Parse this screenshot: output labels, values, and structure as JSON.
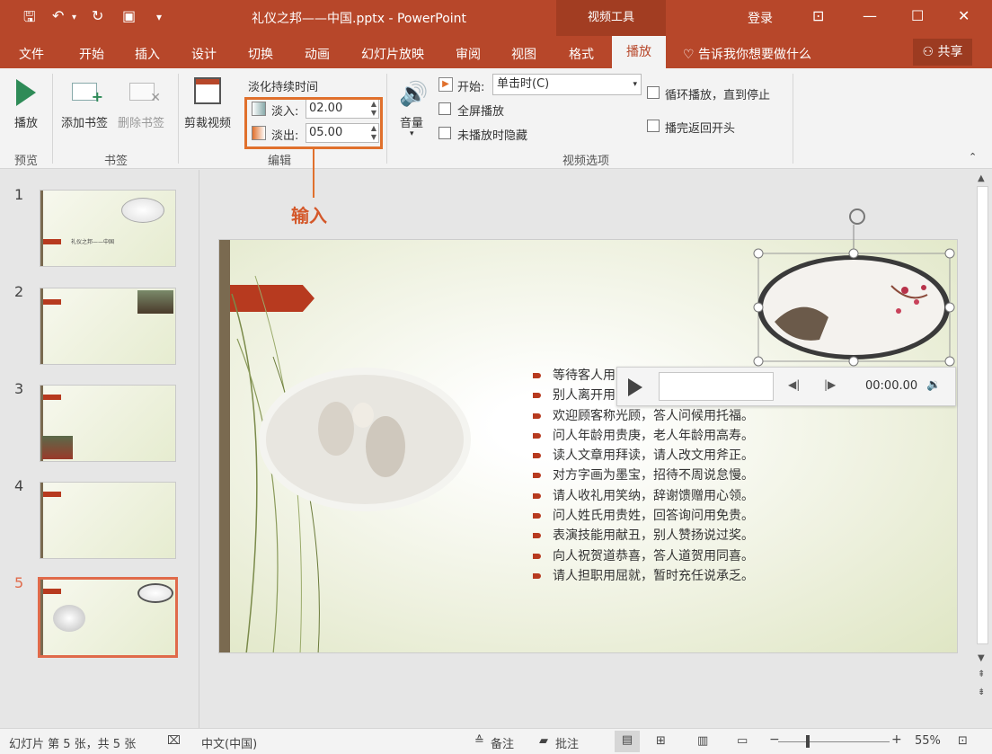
{
  "titlebar": {
    "title": "礼仪之邦——中国.pptx  -  PowerPoint",
    "context_tab": "视频工具",
    "login": "登录"
  },
  "tabs": {
    "file": "文件",
    "home": "开始",
    "insert": "插入",
    "design": "设计",
    "transitions": "切换",
    "animations": "动画",
    "slideshow": "幻灯片放映",
    "review": "审阅",
    "view": "视图",
    "format": "格式",
    "playback": "播放",
    "tellme": "告诉我你想要做什么",
    "share": "共享"
  },
  "ribbon": {
    "play": "播放",
    "add_bookmark": "添加书签",
    "remove_bookmark": "删除书签",
    "trim_video": "剪裁视频",
    "fade_duration": "淡化持续时间",
    "fade_in_label": "淡入:",
    "fade_in_value": "02.00",
    "fade_out_label": "淡出:",
    "fade_out_value": "05.00",
    "volume": "音量",
    "start_label": "开始:",
    "start_value": "单击时(C)",
    "fullscreen": "全屏播放",
    "hide_not_playing": "未播放时隐藏",
    "loop": "循环播放，直到停止",
    "rewind": "播完返回开头",
    "group_preview": "预览",
    "group_bookmarks": "书签",
    "group_editing": "编辑",
    "group_video_options": "视频选项"
  },
  "callout": "输入",
  "thumbnails": [
    {
      "num": "1",
      "caption": "礼仪之邦——中国"
    },
    {
      "num": "2"
    },
    {
      "num": "3"
    },
    {
      "num": "4"
    },
    {
      "num": "5"
    }
  ],
  "slide": {
    "lines": [
      "等待客人用",
      "别人离开用",
      "欢迎顾客称光顾，答人问候用托福。",
      "问人年龄用贵庚，老人年龄用高寿。",
      "读人文章用拜读，请人改文用斧正。",
      "对方字画为墨宝，招待不周说怠慢。",
      "请人收礼用笑纳，辞谢馈赠用心领。",
      "问人姓氏用贵姓，回答询问用免贵。",
      "表演技能用献丑，别人赞扬说过奖。",
      "向人祝贺道恭喜，答人道贺用同喜。",
      "请人担职用屈就，暂时充任说承乏。"
    ],
    "video_time": "00:00.00"
  },
  "statusbar": {
    "slide_info": "幻灯片 第 5 张，共 5 张",
    "language": "中文(中国)",
    "notes": "备注",
    "comments": "批注",
    "zoom": "55%"
  },
  "colors": {
    "accent": "#b7472a",
    "highlight": "#e0702c",
    "callout_text": "#d4582a"
  }
}
